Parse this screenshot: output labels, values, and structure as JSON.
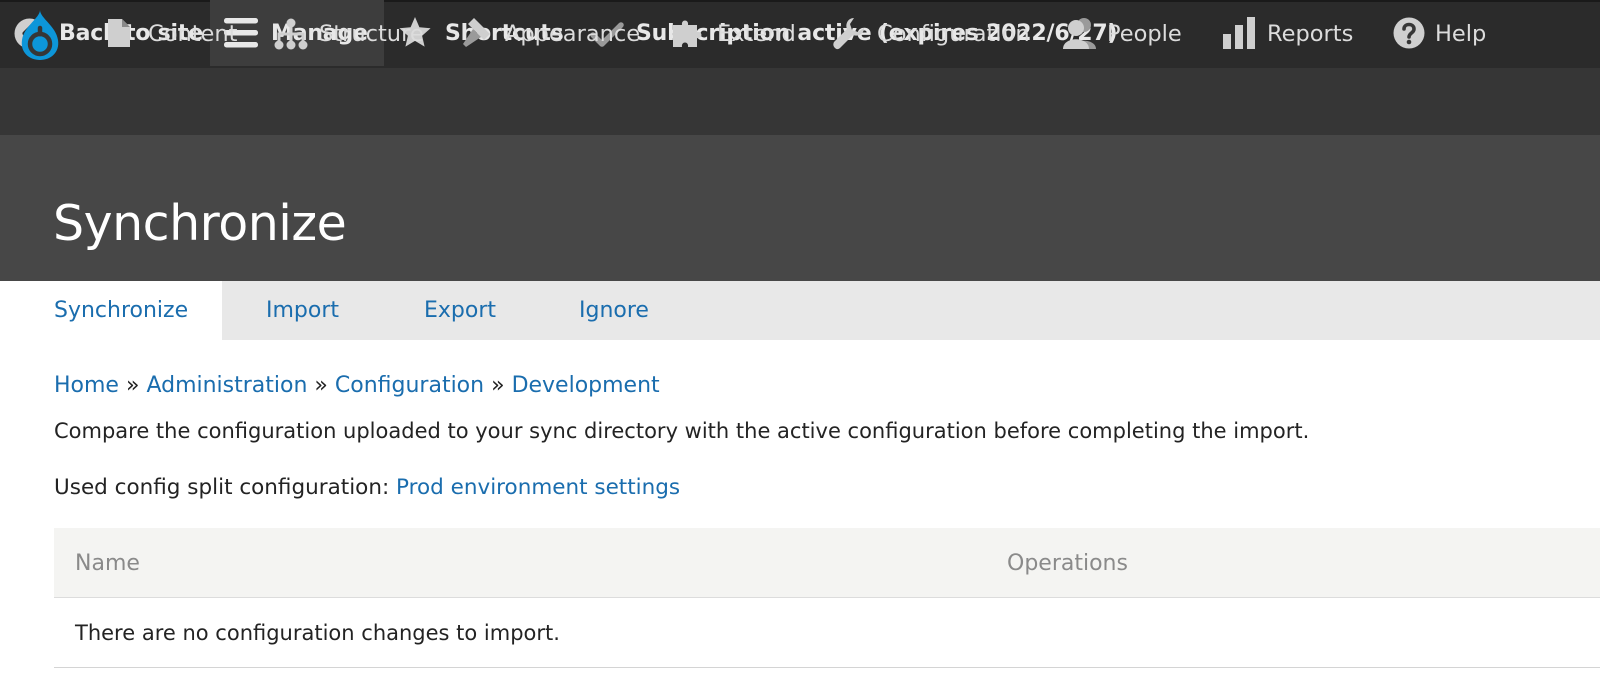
{
  "toolbar": {
    "back_label": "Back to site",
    "manage_label": "Manage",
    "shortcuts_label": "Shortcuts",
    "subscription_label": "Subscription active (expires 2022/6/27)"
  },
  "admin_menu": {
    "items": [
      {
        "label": "Content",
        "icon": "document-icon"
      },
      {
        "label": "Structure",
        "icon": "sitemap-icon"
      },
      {
        "label": "Appearance",
        "icon": "paint-brush-icon"
      },
      {
        "label": "Extend",
        "icon": "puzzle-icon"
      },
      {
        "label": "Configuration",
        "icon": "wrench-icon"
      },
      {
        "label": "People",
        "icon": "people-icon"
      },
      {
        "label": "Reports",
        "icon": "bar-chart-icon"
      },
      {
        "label": "Help",
        "icon": "help-icon"
      }
    ]
  },
  "page": {
    "title": "Synchronize"
  },
  "tabs": [
    {
      "label": "Synchronize",
      "active": true
    },
    {
      "label": "Import",
      "active": false
    },
    {
      "label": "Export",
      "active": false
    },
    {
      "label": "Ignore",
      "active": false
    }
  ],
  "breadcrumb": {
    "items": [
      "Home",
      "Administration",
      "Configuration",
      "Development"
    ],
    "separator": "»"
  },
  "content": {
    "description": "Compare the configuration uploaded to your sync directory with the active configuration before completing the import.",
    "split_prefix": "Used config split configuration: ",
    "split_link": "Prod environment settings"
  },
  "table": {
    "headers": [
      "Name",
      "Operations"
    ],
    "empty_message": "There are no configuration changes to import."
  },
  "colors": {
    "link": "#1a6dae",
    "toolbar_bg": "#2b2b2b",
    "tray_bg": "#363636",
    "header_bg": "#474747",
    "drupal_blue": "#0d96d9"
  }
}
